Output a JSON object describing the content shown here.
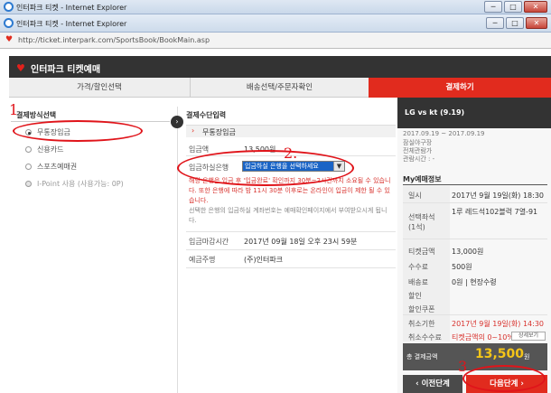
{
  "back_window": {
    "title": "인터파크 티켓 - Internet Explorer"
  },
  "front_window": {
    "title": "인터파크 티켓 - Internet Explorer",
    "minimize": "─",
    "maximize": "□",
    "close": "✕"
  },
  "address_bar": {
    "url": "http://ticket.interpark.com/SportsBook/BookMain.asp"
  },
  "app_header": {
    "title": "인터파크 티켓예매"
  },
  "step_tabs": [
    {
      "label": "가격/할인선택"
    },
    {
      "label": "배송선택/주문자확인"
    },
    {
      "label": "결제하기"
    }
  ],
  "payment_methods": {
    "title": "결제방식선택",
    "options": [
      {
        "label": "무통장입금",
        "selected": true
      },
      {
        "label": "신용카드",
        "selected": false
      },
      {
        "label": "스포츠예매권",
        "selected": false
      },
      {
        "label": "I-Point 사용 (사용가능: 0P)",
        "selected": false
      }
    ]
  },
  "payment_input": {
    "title": "결제수단입력",
    "selected_method": "무통장입금",
    "amount_label": "입금액",
    "amount_value": "13,500원",
    "bank_label": "입금하실은행",
    "bank_select_value": "입금하실 은행을 선택하세요",
    "notice_red": "해당 은행은 입금 후 '입금완료' 확인까지 30분~2시간까지 소요될 수 있습니다. 또한 은행에 따라 밤 11시 30분 이후로는 온라인이 입금이 제한 될 수 있습니다.",
    "notice_grey": "선택한 은행의 입금하실 계좌번호는 예매확인페이지에서 부여받으시게 됩니다.",
    "deadline_label": "입금마감시간",
    "deadline_value": "2017년 09월 18일 오후 23시 59분",
    "depositor_label": "예금주명",
    "depositor_value": "(주)인터파크"
  },
  "game": {
    "title": "LG vs kt (9.19)",
    "period": "2017.09.19 ~ 2017.09.19",
    "venue": "잠실야구장",
    "age": "전체관람가",
    "runtime": "관람시간 : -"
  },
  "my_booking": {
    "title": "My예매정보",
    "rows": [
      {
        "label": "일시",
        "value": "2017년 9월 19일(화) 18:30"
      },
      {
        "label": "선택좌석\n(1석)",
        "value": "1루 레드석102블럭 7열-91"
      },
      {
        "label": "티켓금액",
        "value": "13,000원"
      },
      {
        "label": "수수료",
        "value": "500원"
      },
      {
        "label": "배송료",
        "value": "0원 | 현장수령"
      },
      {
        "label": "할인",
        "value": ""
      },
      {
        "label": "할인쿠폰",
        "value": ""
      },
      {
        "label": "취소기한",
        "value": "2017년 9월 19일(화) 14:30"
      },
      {
        "label": "취소수수료",
        "value": "티켓금액의 0~10%"
      }
    ],
    "detail_button": "상세보기",
    "total_label": "총 결제금액",
    "total_value": "13,500",
    "total_unit": "원"
  },
  "buttons": {
    "prev": "이전단계",
    "next": "다음단계"
  },
  "annotations": {
    "n1": "1",
    "n2": "2.",
    "n3": "3"
  },
  "colors": {
    "accent": "#e12b1e",
    "annotation": "#e0141a",
    "dark": "#333333"
  }
}
